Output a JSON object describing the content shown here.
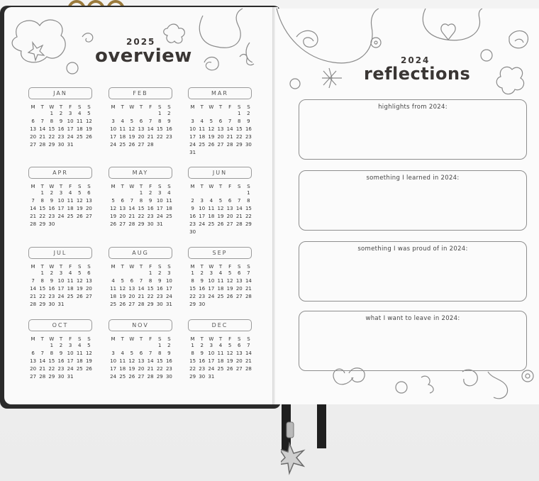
{
  "left_page": {
    "year": "2025",
    "title": "overview",
    "weekday_labels": [
      "M",
      "T",
      "W",
      "T",
      "F",
      "S",
      "S"
    ],
    "months": [
      {
        "name": "JAN",
        "offset": 2,
        "days": 31
      },
      {
        "name": "FEB",
        "offset": 5,
        "days": 28
      },
      {
        "name": "MAR",
        "offset": 5,
        "days": 31
      },
      {
        "name": "APR",
        "offset": 1,
        "days": 30
      },
      {
        "name": "MAY",
        "offset": 3,
        "days": 31
      },
      {
        "name": "JUN",
        "offset": 6,
        "days": 30
      },
      {
        "name": "JUL",
        "offset": 1,
        "days": 31
      },
      {
        "name": "AUG",
        "offset": 4,
        "days": 31
      },
      {
        "name": "SEP",
        "offset": 0,
        "days": 30
      },
      {
        "name": "OCT",
        "offset": 2,
        "days": 31
      },
      {
        "name": "NOV",
        "offset": 5,
        "days": 30
      },
      {
        "name": "DEC",
        "offset": 0,
        "days": 31
      }
    ]
  },
  "right_page": {
    "year": "2024",
    "title": "reflections",
    "prompts": [
      "highlights from 2024:",
      "something I learned in 2024:",
      "something I was proud of in 2024:",
      "what I want to leave in 2024:"
    ]
  },
  "colors": {
    "ink": "#3a3634",
    "line": "#9a9a9a",
    "cover": "#2b2b2b"
  }
}
